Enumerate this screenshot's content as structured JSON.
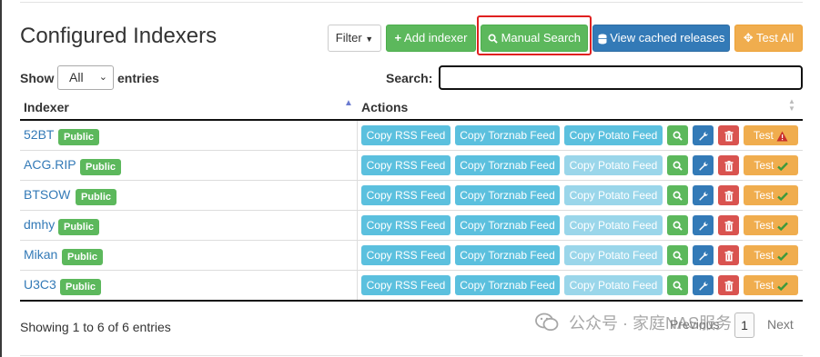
{
  "page": {
    "title": "Configured Indexers"
  },
  "toolbar": {
    "filter_label": "Filter",
    "add_indexer_label": "Add indexer",
    "manual_search_label": "Manual Search",
    "view_cached_label": "View cached releases",
    "test_all_label": "Test All"
  },
  "length_menu": {
    "show_label": "Show",
    "selected": "All",
    "entries_label": "entries"
  },
  "search": {
    "label": "Search:",
    "value": ""
  },
  "table": {
    "headers": [
      "Indexer",
      "Actions"
    ],
    "action_labels": {
      "rss": "Copy RSS Feed",
      "torznab": "Copy Torznab Feed",
      "potato": "Copy Potato Feed",
      "test": "Test"
    },
    "rows": [
      {
        "name": "52BT",
        "badge": "Public",
        "test_status": "warning"
      },
      {
        "name": "ACG.RIP",
        "badge": "Public",
        "test_status": "ok"
      },
      {
        "name": "BTSOW",
        "badge": "Public",
        "test_status": "ok"
      },
      {
        "name": "dmhy",
        "badge": "Public",
        "test_status": "ok"
      },
      {
        "name": "Mikan",
        "badge": "Public",
        "test_status": "ok"
      },
      {
        "name": "U3C3",
        "badge": "Public",
        "test_status": "ok"
      }
    ]
  },
  "footer": {
    "info": "Showing 1 to 6 of 6 entries",
    "pager": {
      "previous": "Previous",
      "current": "1",
      "next": "Next"
    }
  },
  "watermark": {
    "text": "公众号 · 家庭NAS服务"
  },
  "colors": {
    "success": "#5cb85c",
    "primary": "#337ab7",
    "info": "#5bc0de",
    "danger": "#d9534f",
    "warning": "#f0ad4e",
    "highlight": "#e02020"
  }
}
